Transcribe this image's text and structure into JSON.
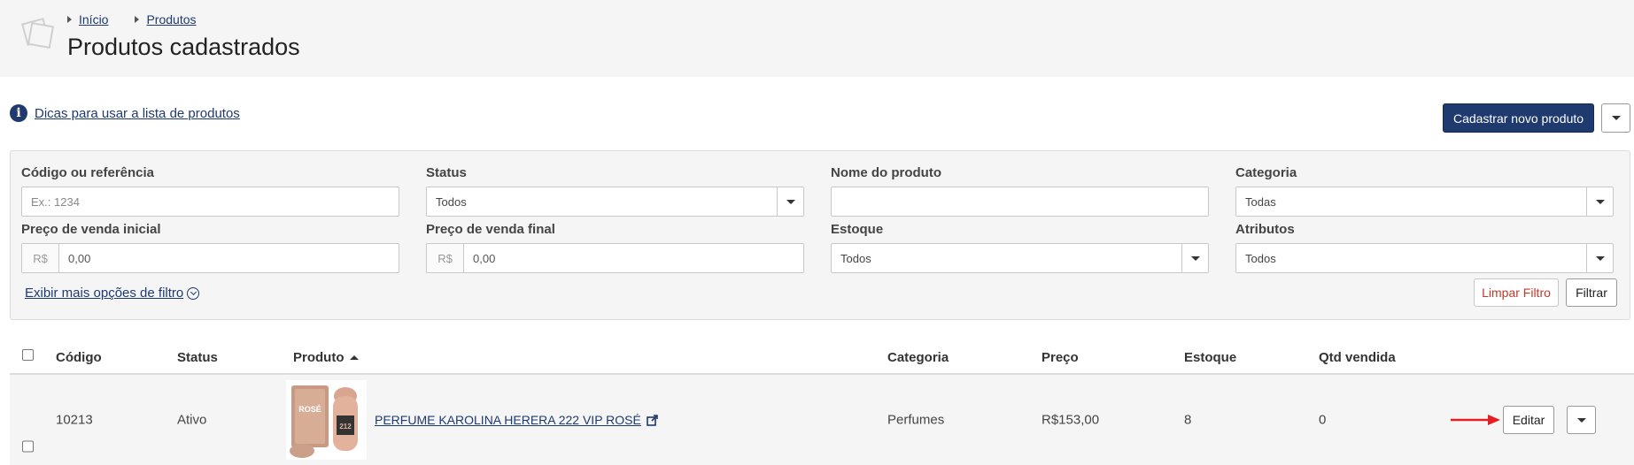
{
  "breadcrumb": [
    {
      "label": "Início"
    },
    {
      "label": "Produtos"
    }
  ],
  "page": {
    "title": "Produtos cadastrados"
  },
  "tips": {
    "link": "Dicas para usar a lista de produtos"
  },
  "actions": {
    "new_product": "Cadastrar novo produto"
  },
  "filters": {
    "codigo": {
      "label": "Código ou referência",
      "placeholder": "Ex.: 1234"
    },
    "status": {
      "label": "Status",
      "value": "Todos"
    },
    "nome": {
      "label": "Nome do produto",
      "value": ""
    },
    "categoria": {
      "label": "Categoria",
      "value": "Todas"
    },
    "preco_inicial": {
      "label": "Preço de venda inicial",
      "prefix": "R$",
      "value": "0,00"
    },
    "preco_final": {
      "label": "Preço de venda final",
      "prefix": "R$",
      "value": "0,00"
    },
    "estoque": {
      "label": "Estoque",
      "value": "Todos"
    },
    "atributos": {
      "label": "Atributos",
      "value": "Todos"
    },
    "more_options": "Exibir mais opções de filtro",
    "clear": "Limpar Filtro",
    "apply": "Filtrar"
  },
  "table": {
    "columns": [
      "Código",
      "Status",
      "Produto",
      "Categoria",
      "Preço",
      "Estoque",
      "Qtd vendida"
    ],
    "rows": [
      {
        "codigo": "10213",
        "status": "Ativo",
        "produto": "PERFUME KAROLINA HERERA 222 VIP ROSÉ",
        "categoria": "Perfumes",
        "preco": "R$153,00",
        "estoque": "8",
        "qtd_vendida": "0",
        "edit": "Editar",
        "img_text": {
          "brand": "ROSÉ",
          "model": "212"
        }
      }
    ]
  },
  "colors": {
    "primary": "#1e3a6e",
    "danger": "#c0392b",
    "panel": "#f5f5f5",
    "arrow": "#e31e24"
  }
}
